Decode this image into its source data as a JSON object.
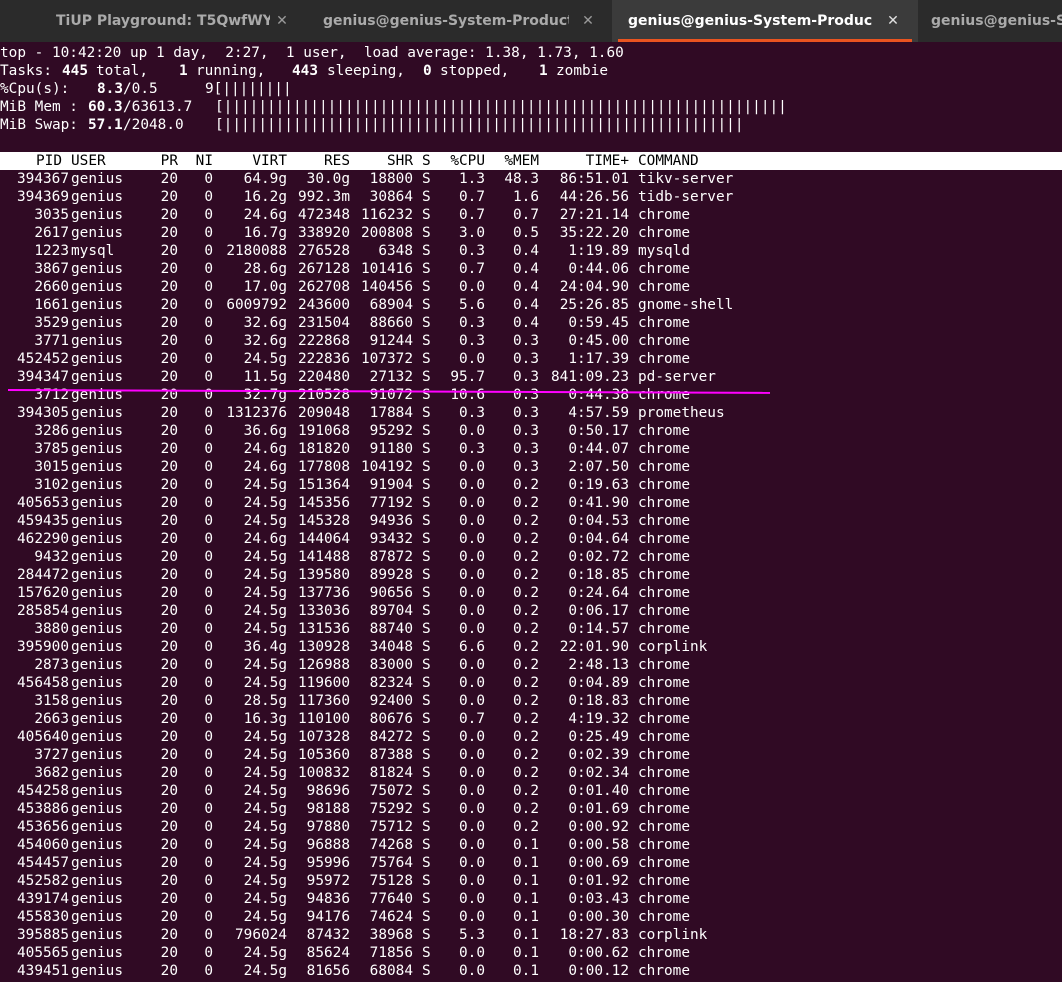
{
  "tabs": [
    {
      "label": "TiUP Playground: T5QwfWY",
      "active": false
    },
    {
      "label": "genius@genius-System-Product-...",
      "active": false
    },
    {
      "label": "genius@genius-System-Product-...",
      "active": true
    },
    {
      "label": "genius@genius-System-Product-...",
      "active": false
    }
  ],
  "close_glyph": "✕",
  "summary": {
    "line1": "top - 10:42:20 up 1 day,  2:27,  1 user,  load average: 1.38, 1.73, 1.60",
    "tasks": {
      "label": "Tasks:",
      "total": "445",
      "total_label": "total,",
      "running": "1",
      "running_label": "running,",
      "sleeping": "443",
      "sleeping_label": "sleeping,",
      "stopped": "0",
      "stopped_label": "stopped,",
      "zombie": "1",
      "zombie_label": "zombie"
    },
    "cpu": {
      "label": "%Cpu(s):",
      "value": "8.3",
      "rest": "/0.5",
      "bar": "9[||||||||"
    },
    "mem": {
      "label": "MiB Mem :",
      "value": "60.3",
      "rest": "/63613.7",
      "bar": "[|||||||||||||||||||||||||||||||||||||||||||||||||||||||||||||||||"
    },
    "swap": {
      "label": "MiB Swap:",
      "value": "57.1",
      "rest": "/2048.0",
      "bar": "[||||||||||||||||||||||||||||||||||||||||||||||||||||||||||||"
    }
  },
  "columns": [
    "PID",
    "USER",
    "PR",
    "NI",
    "VIRT",
    "RES",
    "SHR",
    "S",
    "%CPU",
    "%MEM",
    "TIME+",
    "COMMAND"
  ],
  "processes": [
    [
      "394367",
      "genius",
      "20",
      "0",
      "64.9g",
      "30.0g",
      "18800",
      "S",
      "1.3",
      "48.3",
      "86:51.01",
      "tikv-server"
    ],
    [
      "394369",
      "genius",
      "20",
      "0",
      "16.2g",
      "992.3m",
      "30864",
      "S",
      "0.7",
      "1.6",
      "44:26.56",
      "tidb-server"
    ],
    [
      "3035",
      "genius",
      "20",
      "0",
      "24.6g",
      "472348",
      "116232",
      "S",
      "0.7",
      "0.7",
      "27:21.14",
      "chrome"
    ],
    [
      "2617",
      "genius",
      "20",
      "0",
      "16.7g",
      "338920",
      "200808",
      "S",
      "3.0",
      "0.5",
      "35:22.20",
      "chrome"
    ],
    [
      "1223",
      "mysql",
      "20",
      "0",
      "2180088",
      "276528",
      "6348",
      "S",
      "0.3",
      "0.4",
      "1:19.89",
      "mysqld"
    ],
    [
      "3867",
      "genius",
      "20",
      "0",
      "28.6g",
      "267128",
      "101416",
      "S",
      "0.7",
      "0.4",
      "0:44.06",
      "chrome"
    ],
    [
      "2660",
      "genius",
      "20",
      "0",
      "17.0g",
      "262708",
      "140456",
      "S",
      "0.0",
      "0.4",
      "24:04.90",
      "chrome"
    ],
    [
      "1661",
      "genius",
      "20",
      "0",
      "6009792",
      "243600",
      "68904",
      "S",
      "5.6",
      "0.4",
      "25:26.85",
      "gnome-shell"
    ],
    [
      "3529",
      "genius",
      "20",
      "0",
      "32.6g",
      "231504",
      "88660",
      "S",
      "0.3",
      "0.4",
      "0:59.45",
      "chrome"
    ],
    [
      "3771",
      "genius",
      "20",
      "0",
      "32.6g",
      "222868",
      "91244",
      "S",
      "0.3",
      "0.3",
      "0:45.00",
      "chrome"
    ],
    [
      "452452",
      "genius",
      "20",
      "0",
      "24.5g",
      "222836",
      "107372",
      "S",
      "0.0",
      "0.3",
      "1:17.39",
      "chrome"
    ],
    [
      "394347",
      "genius",
      "20",
      "0",
      "11.5g",
      "220480",
      "27132",
      "S",
      "95.7",
      "0.3",
      "841:09.23",
      "pd-server"
    ],
    [
      "3712",
      "genius",
      "20",
      "0",
      "32.7g",
      "210528",
      "91072",
      "S",
      "10.6",
      "0.3",
      "0:44.38",
      "chrome"
    ],
    [
      "394305",
      "genius",
      "20",
      "0",
      "1312376",
      "209048",
      "17884",
      "S",
      "0.3",
      "0.3",
      "4:57.59",
      "prometheus"
    ],
    [
      "3286",
      "genius",
      "20",
      "0",
      "36.6g",
      "191068",
      "95292",
      "S",
      "0.0",
      "0.3",
      "0:50.17",
      "chrome"
    ],
    [
      "3785",
      "genius",
      "20",
      "0",
      "24.6g",
      "181820",
      "91180",
      "S",
      "0.3",
      "0.3",
      "0:44.07",
      "chrome"
    ],
    [
      "3015",
      "genius",
      "20",
      "0",
      "24.6g",
      "177808",
      "104192",
      "S",
      "0.0",
      "0.3",
      "2:07.50",
      "chrome"
    ],
    [
      "3102",
      "genius",
      "20",
      "0",
      "24.5g",
      "151364",
      "91904",
      "S",
      "0.0",
      "0.2",
      "0:19.63",
      "chrome"
    ],
    [
      "405653",
      "genius",
      "20",
      "0",
      "24.5g",
      "145356",
      "77192",
      "S",
      "0.0",
      "0.2",
      "0:41.90",
      "chrome"
    ],
    [
      "459435",
      "genius",
      "20",
      "0",
      "24.5g",
      "145328",
      "94936",
      "S",
      "0.0",
      "0.2",
      "0:04.53",
      "chrome"
    ],
    [
      "462290",
      "genius",
      "20",
      "0",
      "24.6g",
      "144064",
      "93432",
      "S",
      "0.0",
      "0.2",
      "0:04.64",
      "chrome"
    ],
    [
      "9432",
      "genius",
      "20",
      "0",
      "24.5g",
      "141488",
      "87872",
      "S",
      "0.0",
      "0.2",
      "0:02.72",
      "chrome"
    ],
    [
      "284472",
      "genius",
      "20",
      "0",
      "24.5g",
      "139580",
      "89928",
      "S",
      "0.0",
      "0.2",
      "0:18.85",
      "chrome"
    ],
    [
      "157620",
      "genius",
      "20",
      "0",
      "24.5g",
      "137736",
      "90656",
      "S",
      "0.0",
      "0.2",
      "0:24.64",
      "chrome"
    ],
    [
      "285854",
      "genius",
      "20",
      "0",
      "24.5g",
      "133036",
      "89704",
      "S",
      "0.0",
      "0.2",
      "0:06.17",
      "chrome"
    ],
    [
      "3880",
      "genius",
      "20",
      "0",
      "24.5g",
      "131536",
      "88740",
      "S",
      "0.0",
      "0.2",
      "0:14.57",
      "chrome"
    ],
    [
      "395900",
      "genius",
      "20",
      "0",
      "36.4g",
      "130928",
      "34048",
      "S",
      "6.6",
      "0.2",
      "22:01.90",
      "corplink"
    ],
    [
      "2873",
      "genius",
      "20",
      "0",
      "24.5g",
      "126988",
      "83000",
      "S",
      "0.0",
      "0.2",
      "2:48.13",
      "chrome"
    ],
    [
      "456458",
      "genius",
      "20",
      "0",
      "24.5g",
      "119600",
      "82324",
      "S",
      "0.0",
      "0.2",
      "0:04.89",
      "chrome"
    ],
    [
      "3158",
      "genius",
      "20",
      "0",
      "28.5g",
      "117360",
      "92400",
      "S",
      "0.0",
      "0.2",
      "0:18.83",
      "chrome"
    ],
    [
      "2663",
      "genius",
      "20",
      "0",
      "16.3g",
      "110100",
      "80676",
      "S",
      "0.7",
      "0.2",
      "4:19.32",
      "chrome"
    ],
    [
      "405640",
      "genius",
      "20",
      "0",
      "24.5g",
      "107328",
      "84272",
      "S",
      "0.0",
      "0.2",
      "0:25.49",
      "chrome"
    ],
    [
      "3727",
      "genius",
      "20",
      "0",
      "24.5g",
      "105360",
      "87388",
      "S",
      "0.0",
      "0.2",
      "0:02.39",
      "chrome"
    ],
    [
      "3682",
      "genius",
      "20",
      "0",
      "24.5g",
      "100832",
      "81824",
      "S",
      "0.0",
      "0.2",
      "0:02.34",
      "chrome"
    ],
    [
      "454258",
      "genius",
      "20",
      "0",
      "24.5g",
      "98696",
      "75072",
      "S",
      "0.0",
      "0.2",
      "0:01.40",
      "chrome"
    ],
    [
      "453886",
      "genius",
      "20",
      "0",
      "24.5g",
      "98188",
      "75292",
      "S",
      "0.0",
      "0.2",
      "0:01.69",
      "chrome"
    ],
    [
      "453656",
      "genius",
      "20",
      "0",
      "24.5g",
      "97880",
      "75712",
      "S",
      "0.0",
      "0.2",
      "0:00.92",
      "chrome"
    ],
    [
      "454060",
      "genius",
      "20",
      "0",
      "24.5g",
      "96888",
      "74268",
      "S",
      "0.0",
      "0.1",
      "0:00.58",
      "chrome"
    ],
    [
      "454457",
      "genius",
      "20",
      "0",
      "24.5g",
      "95996",
      "75764",
      "S",
      "0.0",
      "0.1",
      "0:00.69",
      "chrome"
    ],
    [
      "452582",
      "genius",
      "20",
      "0",
      "24.5g",
      "95972",
      "75128",
      "S",
      "0.0",
      "0.1",
      "0:01.92",
      "chrome"
    ],
    [
      "439174",
      "genius",
      "20",
      "0",
      "24.5g",
      "94836",
      "77640",
      "S",
      "0.0",
      "0.1",
      "0:03.43",
      "chrome"
    ],
    [
      "455830",
      "genius",
      "20",
      "0",
      "24.5g",
      "94176",
      "74624",
      "S",
      "0.0",
      "0.1",
      "0:00.30",
      "chrome"
    ],
    [
      "395885",
      "genius",
      "20",
      "0",
      "796024",
      "87432",
      "38968",
      "S",
      "5.3",
      "0.1",
      "18:27.83",
      "corplink"
    ],
    [
      "405565",
      "genius",
      "20",
      "0",
      "24.5g",
      "85624",
      "71856",
      "S",
      "0.0",
      "0.1",
      "0:00.62",
      "chrome"
    ],
    [
      "439451",
      "genius",
      "20",
      "0",
      "24.5g",
      "81656",
      "68084",
      "S",
      "0.0",
      "0.1",
      "0:00.12",
      "chrome"
    ]
  ],
  "colors": {
    "terminal_bg": "#300a24",
    "tabbar_bg": "#2b2b2b",
    "active_tab_accent": "#e95420",
    "annotation": "#ff00ff"
  }
}
